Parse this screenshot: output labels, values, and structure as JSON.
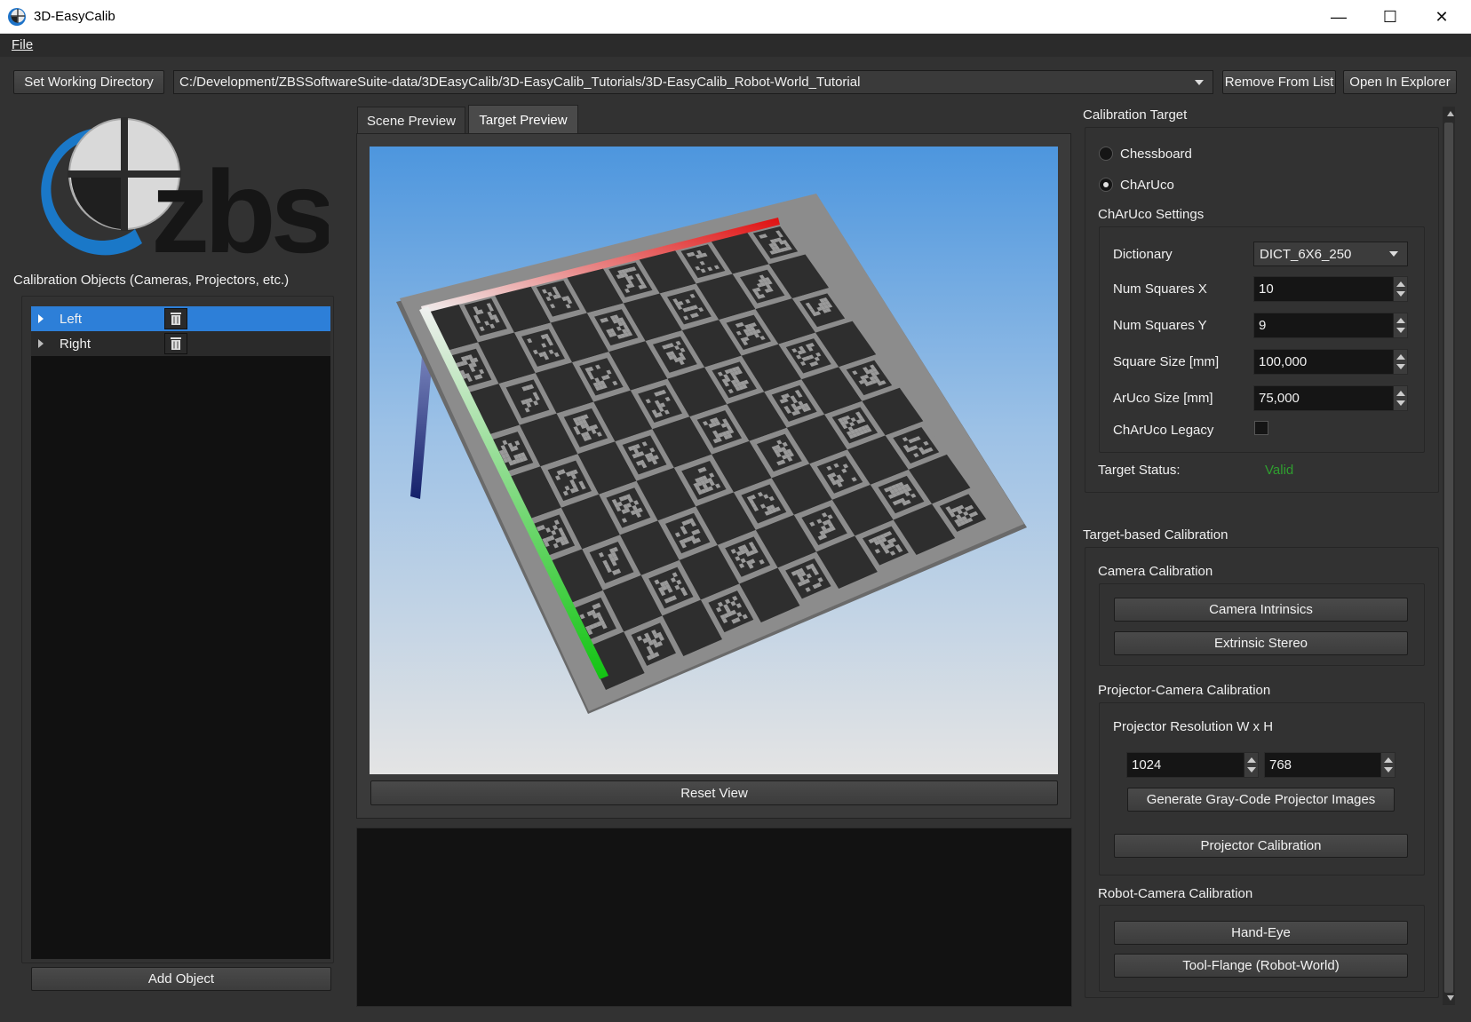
{
  "window": {
    "title": "3D-EasyCalib"
  },
  "menu": {
    "file": "File"
  },
  "toolbar": {
    "set_dir": "Set Working Directory",
    "path": "C:/Development/ZBSSoftwareSuite-data/3DEasyCalib/3D-EasyCalib_Tutorials/3D-EasyCalib_Robot-World_Tutorial",
    "remove": "Remove From List",
    "open_explorer": "Open In Explorer"
  },
  "left": {
    "logo_text": "zbs",
    "objects_label": "Calibration Objects (Cameras, Projectors, etc.)",
    "items": [
      {
        "label": "Left"
      },
      {
        "label": "Right"
      }
    ],
    "add_object": "Add Object"
  },
  "center": {
    "tabs": [
      {
        "label": "Scene Preview"
      },
      {
        "label": "Target Preview"
      }
    ],
    "reset_view": "Reset View"
  },
  "right": {
    "calibration_target": "Calibration Target",
    "radio_chessboard": "Chessboard",
    "radio_charuco": "ChArUco",
    "charuco_settings": "ChArUco Settings",
    "dictionary_label": "Dictionary",
    "dictionary_value": "DICT_6X6_250",
    "num_x_label": "Num Squares X",
    "num_x_value": "10",
    "num_y_label": "Num Squares Y",
    "num_y_value": "9",
    "square_size_label": "Square Size [mm]",
    "square_size_value": "100,000",
    "aruco_size_label": "ArUco Size [mm]",
    "aruco_size_value": "75,000",
    "legacy_label": "ChArUco Legacy",
    "target_status_label": "Target Status:",
    "target_status_value": "Valid",
    "target_based": "Target-based Calibration",
    "camera_calibration": "Camera Calibration",
    "camera_intrinsics": "Camera Intrinsics",
    "extrinsic_stereo": "Extrinsic Stereo",
    "projector_camera": "Projector-Camera Calibration",
    "projector_resolution": "Projector Resolution W x H",
    "proj_w": "1024",
    "proj_h": "768",
    "gray_code": "Generate Gray-Code Projector Images",
    "projector_calibration": "Projector Calibration",
    "robot_camera": "Robot-Camera Calibration",
    "hand_eye": "Hand-Eye",
    "tool_flange": "Tool-Flange (Robot-World)"
  },
  "colors": {
    "selection": "#2d7fd8",
    "status_valid": "#2f9e2f",
    "axis_red": "#e01010",
    "axis_green": "#12c412",
    "axis_blue": "#14206a"
  }
}
